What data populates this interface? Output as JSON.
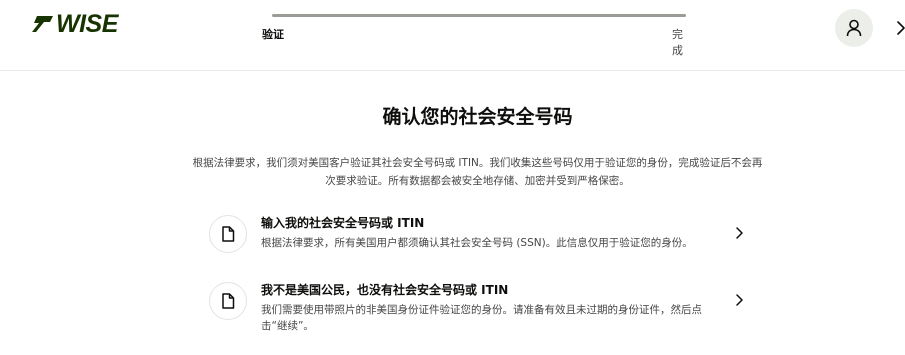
{
  "header": {
    "logo_text": "WISE",
    "stepper": {
      "steps": [
        {
          "label": "验证",
          "active": true
        },
        {
          "label": "完成",
          "active": false
        }
      ]
    },
    "avatar_icon": "user-icon",
    "close_icon": "chevron-right-icon"
  },
  "main": {
    "title": "确认您的社会安全号码",
    "description": "根据法律要求，我们须对美国客户验证其社会安全号码或 ITIN。我们收集这些号码仅用于验证您的身份，完成验证后不会再次要求验证。所有数据都会被安全地存储、加密并受到严格保密。",
    "options": [
      {
        "icon": "document-icon",
        "title": "输入我的社会安全号码或 ITIN",
        "description": "根据法律要求，所有美国用户都须确认其社会安全号码 (SSN)。此信息仅用于验证您的身份。"
      },
      {
        "icon": "document-icon",
        "title": "我不是美国公民，也没有社会安全号码或 ITIN",
        "description": "我们需要使用带照片的非美国身份证件验证您的身份。请准备有效且未过期的身份证件，然后点击“继续”。"
      }
    ]
  },
  "colors": {
    "brand": "#163300",
    "text": "#0e0f0c",
    "muted": "#454745",
    "stepper_track": "#9a9c98",
    "avatar_bg": "#eceeea"
  }
}
